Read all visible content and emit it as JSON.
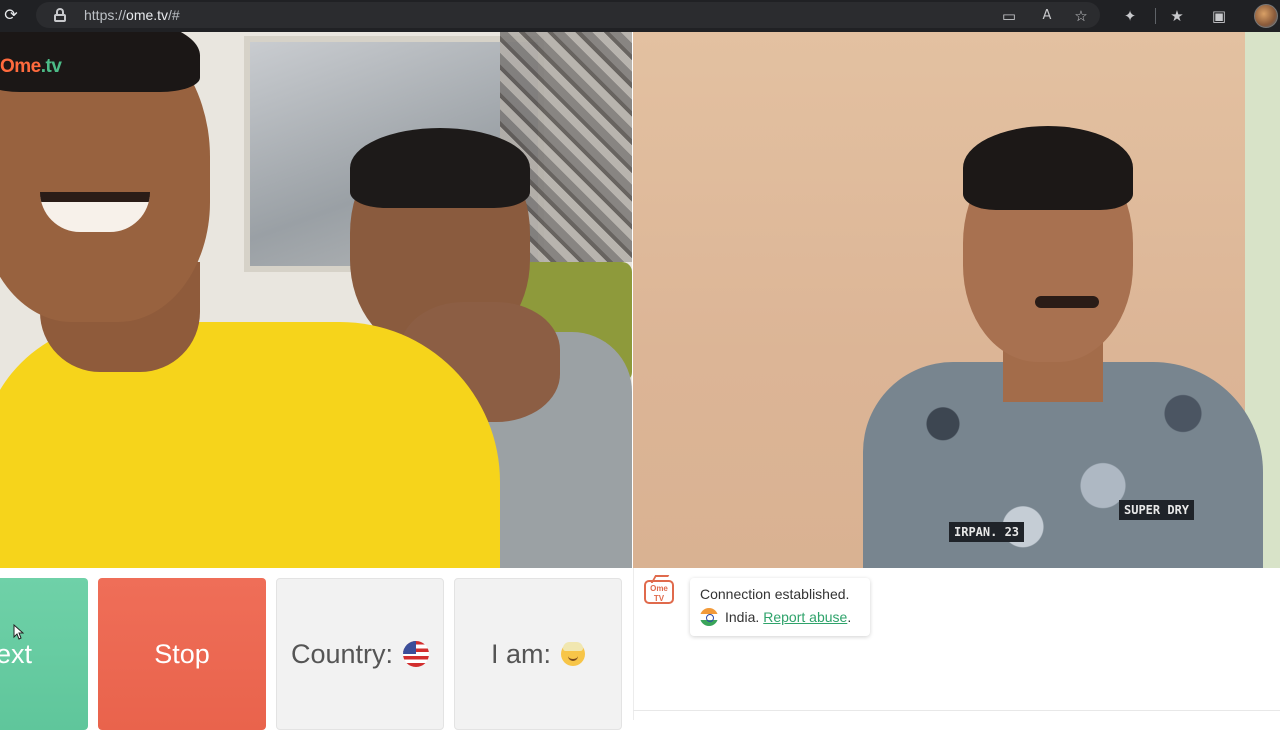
{
  "browser": {
    "url_scheme": "https://",
    "url_host": "ome.tv",
    "url_path": "/#",
    "icons": [
      "reload-icon",
      "lock-icon",
      "video-camera-icon",
      "read-aloud-icon",
      "add-favorite-icon",
      "extensions-icon",
      "favorites-icon",
      "collections-icon",
      "profile-avatar"
    ]
  },
  "video": {
    "logo_ome": "Ome",
    "logo_tv": ".tv",
    "remote_patch_name": "IRPAN. 23",
    "remote_patch_brand": "SUPER DRY"
  },
  "controls": {
    "next_label": "ext",
    "stop_label": "Stop",
    "country_label": "Country:",
    "country_flag": "us-flag",
    "iam_label": "I am:",
    "iam_icon": "man-emoji"
  },
  "chat": {
    "icon_text": "Ome TV",
    "status": "Connection established.",
    "country": "India.",
    "report_label": "Report abuse",
    "report_suffix": "."
  },
  "colors": {
    "next": "#5fc69b",
    "stop": "#e9634c",
    "report_link": "#2fa36b",
    "browser_bar": "#202124"
  }
}
